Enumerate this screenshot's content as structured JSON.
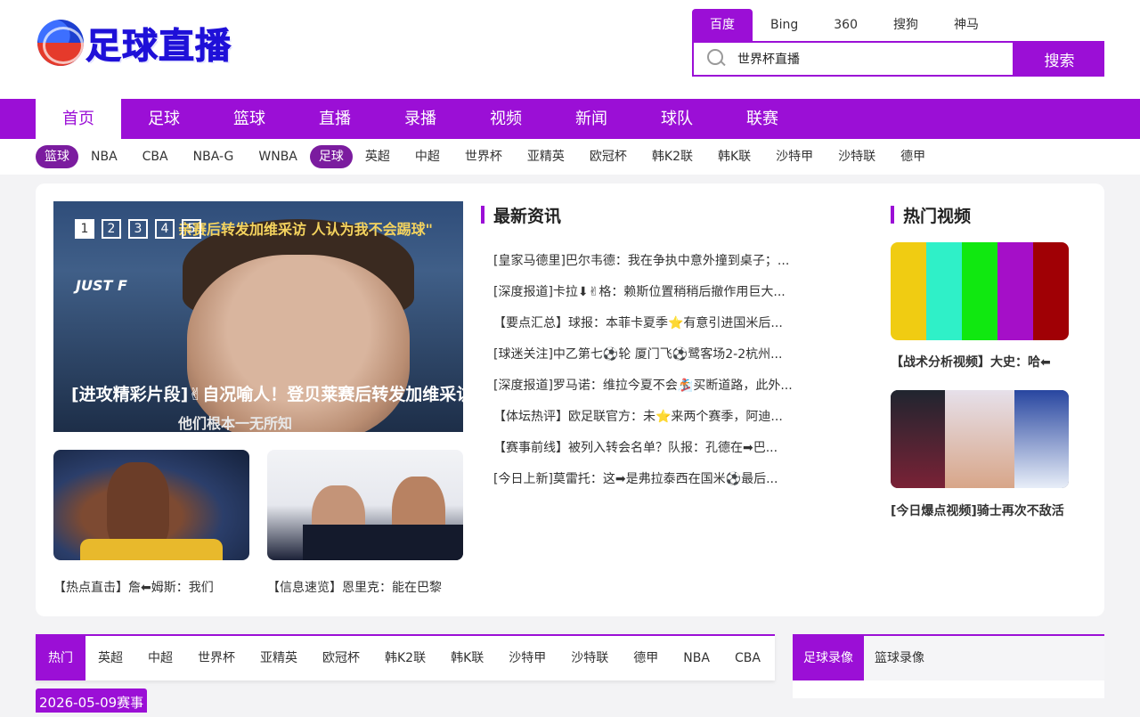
{
  "header": {
    "logo_text": "足球直播",
    "search_tabs": [
      "百度",
      "Bing",
      "360",
      "搜狗",
      "神马"
    ],
    "search_value": "世界杯直播",
    "search_button": "搜索"
  },
  "main_nav": [
    "首页",
    "足球",
    "篮球",
    "直播",
    "录播",
    "视频",
    "新闻",
    "球队",
    "联赛"
  ],
  "sub_nav": {
    "basketball_tag": "篮球",
    "basketball": [
      "NBA",
      "CBA",
      "NBA-G",
      "WNBA"
    ],
    "football_tag": "足球",
    "football": [
      "英超",
      "中超",
      "世界杯",
      "亚精英",
      "欧冠杯",
      "韩K2联",
      "韩K联",
      "沙特甲",
      "沙特联",
      "德甲"
    ]
  },
  "slider": {
    "pages": [
      "1",
      "2",
      "3",
      "4",
      "5"
    ],
    "active_page": 1,
    "image_text_top": "亲赛后转发加维采访 人认为我不会踢球\"",
    "sign_text": "JUST F",
    "title": "[进攻精彩片段]✌自况喻人！登贝莱赛后转发加维采访",
    "bottom_text": "他们根本一无所知"
  },
  "thumbs": [
    {
      "caption": "【热点直击】詹⬅姆斯：我们"
    },
    {
      "caption": "【信息速览】恩里克：能在巴黎"
    }
  ],
  "news": {
    "title": "最新资讯",
    "items": [
      "[皇家马德里]巴尔韦德：我在争执中意外撞到桌子；...",
      "[深度报道]卡拉⬇✌格：赖斯位置稍稍后撤作用巨大...",
      "【要点汇总】球报：本菲卡夏季⭐有意引进国米后...",
      "[球迷关注]中乙第七⚽轮 厦门飞⚽鹭客场2-2杭州...",
      "[深度报道]罗马诺：维拉今夏不会🏂买断道路，此外...",
      "【体坛热评】欧足联官方：未⭐来两个赛季，阿迪...",
      "【赛事前线】被列入转会名单？队报：孔德在➡巴...",
      "[今日上新]莫雷托：这➡是弗拉泰西在国米⚽最后..."
    ]
  },
  "hot_videos": {
    "title": "热门视频",
    "items": [
      {
        "caption": "【战术分析视频】大史：哈⬅",
        "colors": [
          "#f0cc12",
          "#2ff0c8",
          "#10e810",
          "#a50fc8",
          "#a00005"
        ]
      },
      {
        "caption": "[今日爆点视频]骑士再次不敌活"
      }
    ]
  },
  "bottom_tabs": [
    "热门",
    "英超",
    "中超",
    "世界杯",
    "亚精英",
    "欧冠杯",
    "韩K2联",
    "韩K联",
    "沙特甲",
    "沙特联",
    "德甲",
    "NBA",
    "CBA"
  ],
  "date_tag": "2026-05-09赛事",
  "recordings": [
    "足球录像",
    "篮球录像"
  ],
  "colors": {
    "accent": "#9b0fd6"
  }
}
